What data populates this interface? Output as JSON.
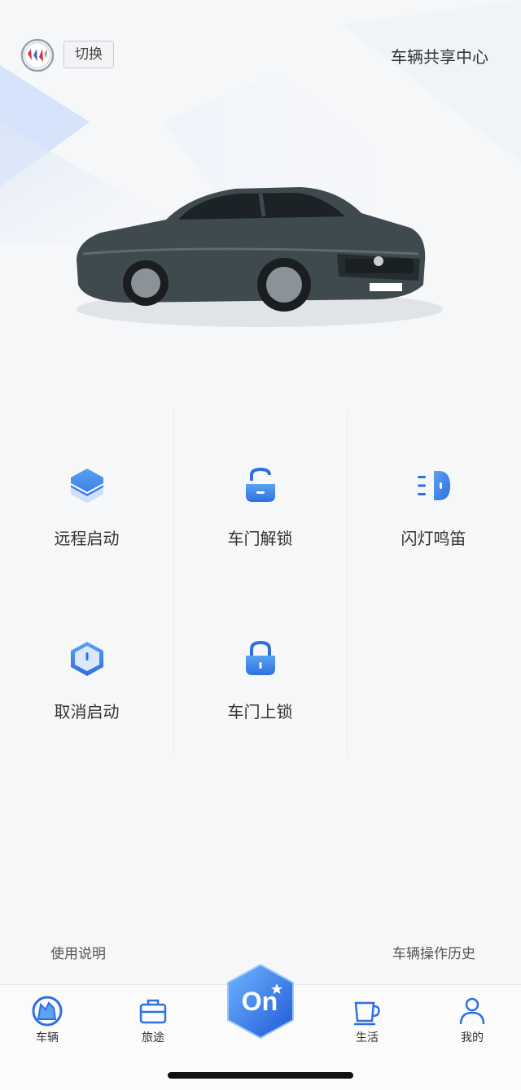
{
  "header": {
    "switch_label": "切换",
    "title": "车辆共享中心"
  },
  "car_image": {
    "name": "buick-sedan"
  },
  "controls": [
    {
      "label": "远程启动",
      "icon": "remote-start-icon"
    },
    {
      "label": "车门解锁",
      "icon": "door-unlock-icon"
    },
    {
      "label": "闪灯鸣笛",
      "icon": "flash-horn-icon"
    },
    {
      "label": "取消启动",
      "icon": "cancel-start-icon"
    },
    {
      "label": "车门上锁",
      "icon": "door-lock-icon"
    }
  ],
  "footer_links": {
    "left": "使用说明",
    "right": "车辆操作历史"
  },
  "tabbar": {
    "tabs": [
      {
        "label": "车辆",
        "icon": "vehicle-icon"
      },
      {
        "label": "旅途",
        "icon": "briefcase-icon"
      },
      {
        "label": "生活",
        "icon": "cup-icon"
      },
      {
        "label": "我的",
        "icon": "person-icon"
      }
    ],
    "center": {
      "label": "On",
      "icon": "onstar-hexagon-icon"
    }
  },
  "colors": {
    "accent": "#2f6fe0",
    "accent_light": "#5aa2f2",
    "text": "#333333",
    "background": "#f6f7f9"
  }
}
